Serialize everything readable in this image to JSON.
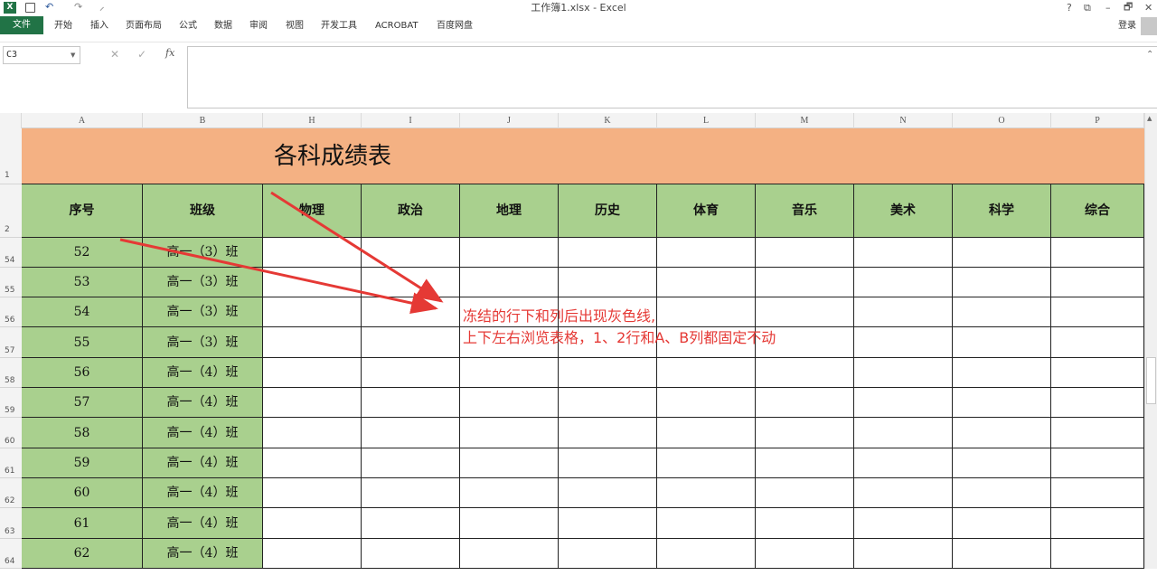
{
  "window": {
    "title": "工作簿1.xlsx - Excel",
    "help": "?",
    "ribbon_display": "⧉",
    "minimize": "–",
    "restore": "🗗",
    "close": "✕",
    "login": "登录"
  },
  "quick_access": {
    "undo": "↶",
    "redo": "↷",
    "customize": "⸝"
  },
  "ribbon": {
    "tabs": [
      "文件",
      "开始",
      "插入",
      "页面布局",
      "公式",
      "数据",
      "审阅",
      "视图",
      "开发工具",
      "ACROBAT",
      "百度网盘"
    ]
  },
  "formula_bar": {
    "name_box": "C3",
    "cancel": "✕",
    "enter": "✓",
    "fx": "fx",
    "formula": "",
    "collapse": "⌃"
  },
  "columns": [
    "A",
    "B",
    "H",
    "I",
    "J",
    "K",
    "L",
    "M",
    "N",
    "O",
    "P"
  ],
  "sheet": {
    "title": "各科成绩表",
    "header_row_number": "2",
    "title_row_number": "1",
    "headers": [
      "序号",
      "班级",
      "物理",
      "政治",
      "地理",
      "历史",
      "体育",
      "音乐",
      "美术",
      "科学",
      "综合"
    ],
    "rows": [
      {
        "row": "54",
        "seq": "52",
        "class": "高一（3）班"
      },
      {
        "row": "55",
        "seq": "53",
        "class": "高一（3）班"
      },
      {
        "row": "56",
        "seq": "54",
        "class": "高一（3）班"
      },
      {
        "row": "57",
        "seq": "55",
        "class": "高一（3）班"
      },
      {
        "row": "58",
        "seq": "56",
        "class": "高一（4）班"
      },
      {
        "row": "59",
        "seq": "57",
        "class": "高一（4）班"
      },
      {
        "row": "60",
        "seq": "58",
        "class": "高一（4）班"
      },
      {
        "row": "61",
        "seq": "59",
        "class": "高一（4）班"
      },
      {
        "row": "62",
        "seq": "60",
        "class": "高一（4）班"
      },
      {
        "row": "63",
        "seq": "61",
        "class": "高一（4）班"
      },
      {
        "row": "64",
        "seq": "62",
        "class": "高一（4）班"
      }
    ]
  },
  "annotation": {
    "line1": "冻结的行下和列后出现灰色线,",
    "line2": "上下左右浏览表格，1、2行和A、B列都固定不动",
    "color": "#e53935"
  },
  "colors": {
    "title_fill": "#f4b183",
    "header_fill": "#a9d08e",
    "excel_green": "#217346"
  }
}
